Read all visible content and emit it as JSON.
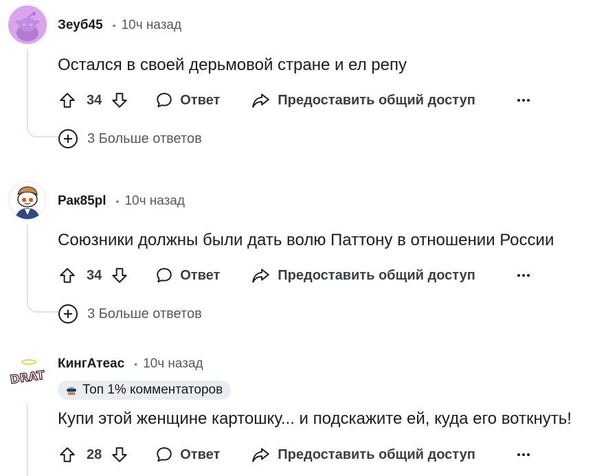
{
  "comments": [
    {
      "username": "Зеуб45",
      "time": "10ч назад",
      "text": "Остался в своей дерьмовой стране и ел репу",
      "votes": "34",
      "reply_label": "Ответ",
      "share_label": "Предоставить общий доступ",
      "more_replies": "3 Больше ответов"
    },
    {
      "username": "Рак85pl",
      "time": "10ч назад",
      "text": "Союзники должны были дать волю Паттону в отношении России",
      "votes": "34",
      "reply_label": "Ответ",
      "share_label": "Предоставить общий доступ",
      "more_replies": "3 Больше ответов"
    },
    {
      "username": "КингАтеас",
      "time": "10ч назад",
      "badge": "Топ 1% комментаторов",
      "text": "Купи этой женщине картошку... и подскажите ей, куда его воткнуть!",
      "votes": "28",
      "reply_label": "Ответ",
      "share_label": "Предоставить общий доступ"
    }
  ],
  "avatar_texts": {
    "third": "DRAT"
  },
  "colors": {
    "avatar1_bg": "#d9a3f0",
    "thread_line": "#e0e3e5",
    "badge_bg": "#eaedef",
    "icon": "#1c1c1c"
  }
}
